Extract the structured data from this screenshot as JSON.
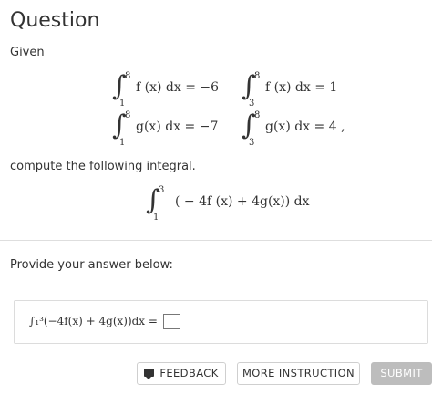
{
  "header": {
    "title": "Question"
  },
  "question": {
    "given_label": "Given",
    "integrals": [
      {
        "sign": "∫",
        "upper": "8",
        "lower": "1",
        "body": "f (x) dx = −6"
      },
      {
        "sign": "∫",
        "upper": "8",
        "lower": "3",
        "body": "f (x) dx = 1"
      },
      {
        "sign": "∫",
        "upper": "8",
        "lower": "1",
        "body": "g(x) dx = −7"
      },
      {
        "sign": "∫",
        "upper": "8",
        "lower": "3",
        "body": "g(x) dx = 4 ,"
      }
    ],
    "compute_label": "compute the following integral.",
    "target": {
      "sign": "∫",
      "upper": "3",
      "lower": "1",
      "body": "( − 4f (x) + 4g(x)) dx"
    }
  },
  "answer": {
    "prompt": "Provide your answer below:",
    "expression": "∫₁³(−4f(x) + 4g(x))dx ="
  },
  "buttons": {
    "feedback": "FEEDBACK",
    "more_instruction": "MORE INSTRUCTION",
    "submit": "SUBMIT"
  }
}
